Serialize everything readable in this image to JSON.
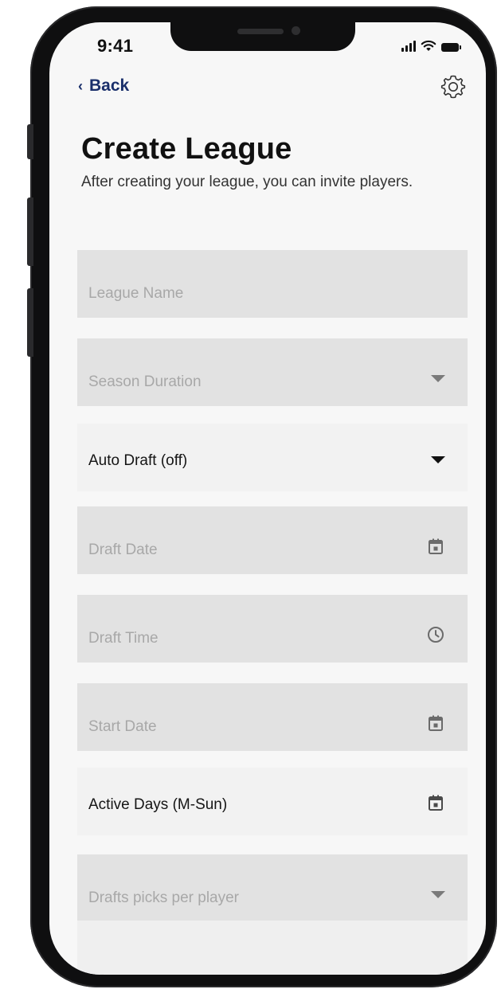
{
  "status_bar": {
    "time": "9:41",
    "icons": [
      "signal-icon",
      "wifi-icon",
      "battery-icon"
    ]
  },
  "nav": {
    "back_label": "Back",
    "back_icon": "chevron-left-icon",
    "settings_icon": "gear-icon"
  },
  "header": {
    "title": "Create League",
    "subtitle": "After creating your league, you can invite players."
  },
  "form": {
    "fields": [
      {
        "label": "League Name",
        "kind": "text",
        "filled": false
      },
      {
        "label": "Season Duration",
        "kind": "select",
        "icon": "caret-down-icon",
        "filled": false
      },
      {
        "label": "Auto Draft (off)",
        "kind": "select",
        "icon": "caret-down-icon",
        "filled": true
      },
      {
        "label": "Draft Date",
        "kind": "date",
        "icon": "calendar-icon",
        "filled": false
      },
      {
        "label": "Draft Time",
        "kind": "time",
        "icon": "clock-icon",
        "filled": false
      },
      {
        "label": "Start Date",
        "kind": "date",
        "icon": "calendar-icon",
        "filled": false
      },
      {
        "label": "Active Days (M-Sun)",
        "kind": "date",
        "icon": "calendar-icon",
        "filled": true
      },
      {
        "label": "Drafts picks per player",
        "kind": "select",
        "icon": "caret-down-icon",
        "filled": false
      }
    ]
  },
  "colors": {
    "accent": "#1a2f6b",
    "field_empty_bg": "#e2e2e2",
    "field_filled_bg": "#f2f2f2",
    "placeholder_text": "#a8a8a8"
  }
}
